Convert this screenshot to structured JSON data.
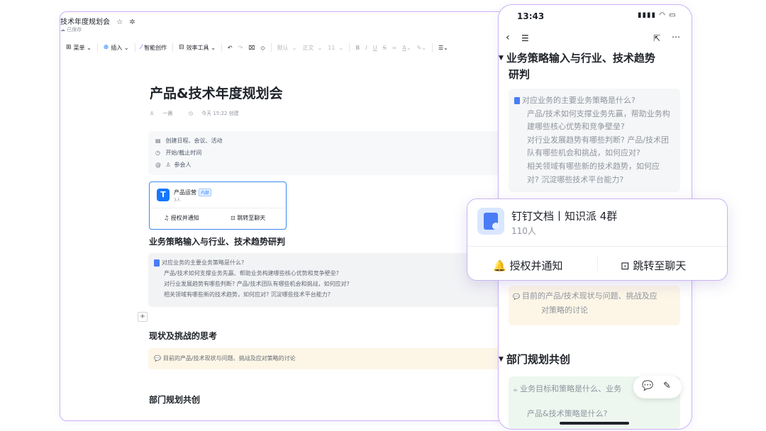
{
  "desktop": {
    "doc_tab_title": "技术年度规划会",
    "saved_status": "已保存",
    "toolbar": {
      "menu": "菜单",
      "insert": "插入",
      "ai_create": "智能创作",
      "efficiency_tools": "效率工具",
      "font_default": "默认",
      "paragraph": "正文",
      "font_size": "11"
    },
    "title": "产品&技术年度规划会",
    "meta": {
      "author": "一晨",
      "created": "今天 15:22 创建"
    },
    "event": {
      "schedule": "创建日程、会议、活动",
      "time": "开始/截止时间",
      "attendees": "参会人"
    },
    "group_card": {
      "name": "产品运营",
      "tag": "内部",
      "count": "3人",
      "authorize": "授权并通知",
      "jump": "跳转至聊天"
    },
    "section1": {
      "heading": "业务策略输入与行业、技术趋势研判",
      "lines": [
        "对应业务的主要业务策略是什么?",
        "产品/技术如何支撑业务先赢、帮助业务构建哪些核心优势和竞争壁垒?",
        "对行业发展趋势有哪些判断? 产品/技术团队有哪些机会和挑战，如何应对?",
        "相关领域有哪些新的技术趋势，如何应对? 沉淀哪些技术平台能力?"
      ]
    },
    "section2": {
      "heading": "现状及挑战的思考",
      "line": "目前的产品/技术现状与问题、挑战及应对策略的讨论"
    },
    "section3": {
      "heading": "部门规划共创"
    }
  },
  "phone": {
    "time": "13:43",
    "status": "▮▮▮▮ ◠ ▭",
    "heading1_a": "业务策略输入与行业、技术趋势",
    "heading1_b": "研判",
    "q_lines": [
      "对应业务的主要业务策略是什么?",
      "产品/技术如何支撑业务先赢，帮助业务构",
      "建哪些核心优势和竞争壁垒?",
      "对行业发展趋势有哪些判断? 产品/技术团",
      "队有哪些机会和挑战，如何应对?",
      "相关领域有哪些新的技术趋势，如何应",
      "对? 沉淀哪些技术平台能力?"
    ],
    "y_line_a": "目前的产品/技术现状与问题、挑战及应",
    "y_line_b": "对策略的讨论",
    "heading2": "部门规划共创",
    "g_line_a": "业务目标和策略是什么、业务",
    "g_line_b": "产品&技术策略是什么?"
  },
  "float_card": {
    "name": "钉钉文档丨知识派 4群",
    "count": "110人",
    "authorize": "授权并通知",
    "jump": "跳转至聊天"
  },
  "colors": {
    "accent": "#1677ff",
    "frame": "#c9b4f4",
    "yellow_block": "#fdf6e7",
    "green_block": "#edf7ef"
  }
}
